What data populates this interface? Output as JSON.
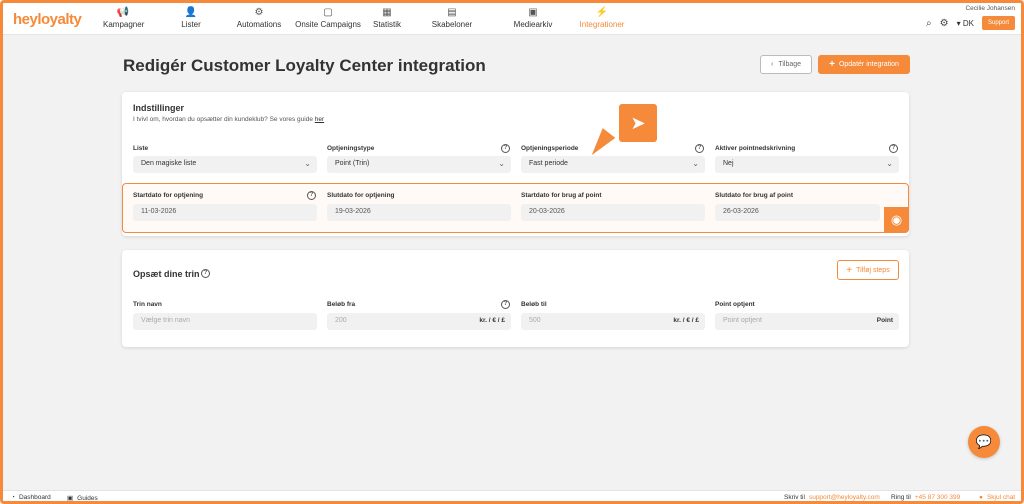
{
  "brand": {
    "logo": "heyloyalty",
    "accent": "#f58a3a"
  },
  "nav": {
    "items": [
      {
        "label": "Kampagner",
        "icon": "megaphone-icon",
        "glyph": "📢"
      },
      {
        "label": "Lister",
        "icon": "person-icon",
        "glyph": "👤"
      },
      {
        "label": "Automations",
        "icon": "flow-icon",
        "glyph": "⚙"
      },
      {
        "label": "Onsite Campaigns",
        "icon": "window-icon",
        "glyph": "▢"
      },
      {
        "label": "Statistik",
        "icon": "chart-icon",
        "glyph": "▦"
      },
      {
        "label": "Skabeloner",
        "icon": "template-icon",
        "glyph": "▤"
      },
      {
        "label": "Mediearkiv",
        "icon": "archive-icon",
        "glyph": "▣"
      },
      {
        "label": "Integrationer",
        "icon": "plug-icon",
        "glyph": "⚡"
      }
    ],
    "user_name": "Cecilie Johansen",
    "language": "DK",
    "support_label": "Support"
  },
  "page": {
    "title": "Redigér Customer Loyalty Center integration",
    "back_label": "Tilbage",
    "update_label": "Opdatér integration"
  },
  "settings": {
    "title": "Indstillinger",
    "subtitle": "I tvivl om, hvordan du opsætter din kundeklub? Se vores guide",
    "guide_link": "her",
    "fields": [
      {
        "label": "Liste",
        "value": "Den magiske liste"
      },
      {
        "label": "Optjeningstype",
        "value": "Point (Trin)"
      },
      {
        "label": "Optjeningsperiode",
        "value": "Fast periode"
      },
      {
        "label": "Aktiver pointnedskrivning",
        "value": "Nej"
      }
    ],
    "dates": [
      {
        "label": "Startdato for optjening",
        "value": "11-03-2026"
      },
      {
        "label": "Slutdato for optjening",
        "value": "19-03-2026"
      },
      {
        "label": "Startdato for brug af point",
        "value": "20-03-2026"
      },
      {
        "label": "Slutdato for brug af point",
        "value": "26-03-2026"
      }
    ]
  },
  "steps": {
    "title": "Opsæt dine trin",
    "add_label": "Tilføj steps",
    "fields": [
      {
        "label": "Trin navn",
        "placeholder": "Vælge trin navn",
        "suffix": ""
      },
      {
        "label": "Beløb fra",
        "placeholder": "200",
        "suffix": "kr. / € / £"
      },
      {
        "label": "Beløb til",
        "placeholder": "500",
        "suffix": "kr. / € / £"
      },
      {
        "label": "Point optjent",
        "placeholder": "Point optjent",
        "suffix": "Point"
      }
    ]
  },
  "footer": {
    "dashboard": "Dashboard",
    "guides": "Guides",
    "write_prefix": "Skriv til",
    "email": "support@heyloyalty.com",
    "call_prefix": "Ring til",
    "phone": "+45 87 300 399",
    "hide_chat": "Skjul chat"
  }
}
